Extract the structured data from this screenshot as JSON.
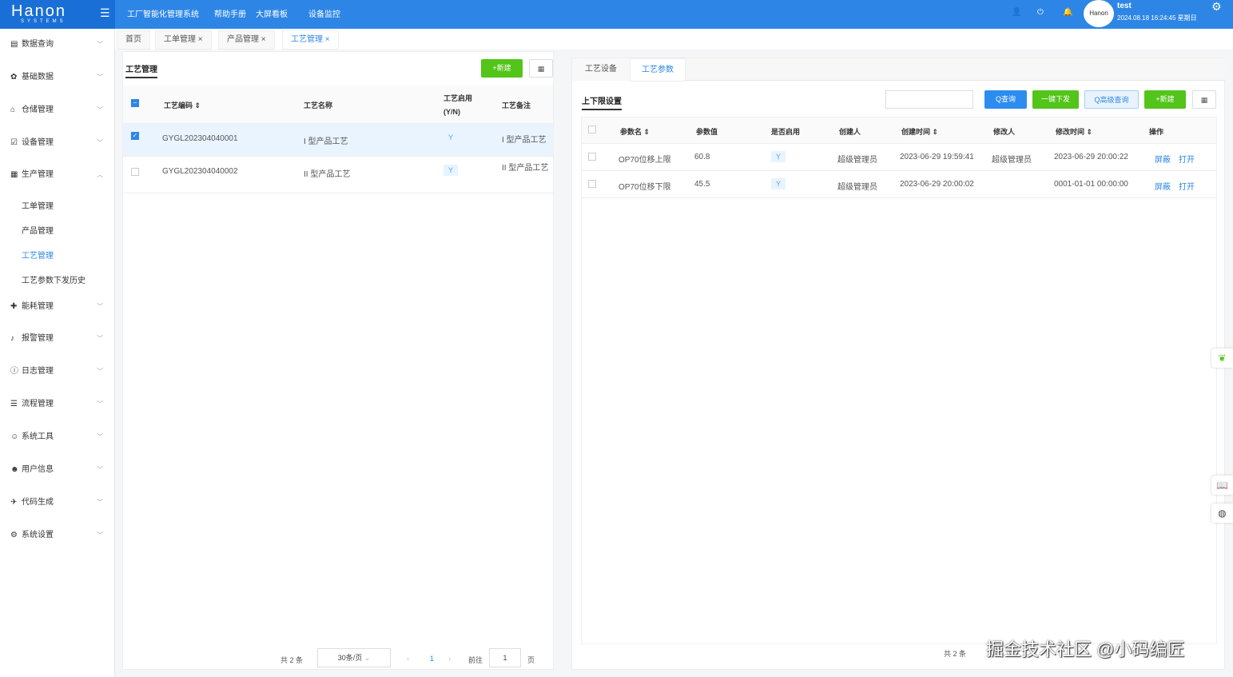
{
  "header": {
    "logo": "Hanon",
    "logo_sub": "SYSTEMS",
    "nav": [
      "工厂智能化管理系统",
      "帮助手册",
      "大屏看板",
      "设备监控"
    ],
    "user": "test",
    "datetime": "2024.08.18 16:24:45 星期日",
    "avatar_text": "Hanon"
  },
  "sidebar": {
    "items": [
      {
        "label": "数据查询",
        "icon": "▤"
      },
      {
        "label": "基础数据",
        "icon": "✿"
      },
      {
        "label": "仓储管理",
        "icon": "⌂"
      },
      {
        "label": "设备管理",
        "icon": "☑"
      },
      {
        "label": "生产管理",
        "icon": "▦"
      },
      {
        "label": "能耗管理",
        "icon": "✚"
      },
      {
        "label": "报警管理",
        "icon": "♪"
      },
      {
        "label": "日志管理",
        "icon": "ⓘ"
      },
      {
        "label": "流程管理",
        "icon": "☰"
      },
      {
        "label": "系统工具",
        "icon": "☺"
      },
      {
        "label": "用户信息",
        "icon": "☻"
      },
      {
        "label": "代码生成",
        "icon": "✈"
      },
      {
        "label": "系统设置",
        "icon": "⚙"
      }
    ],
    "sub_items": [
      "工单管理",
      "产品管理",
      "工艺管理",
      "工艺参数下发历史"
    ],
    "active_sub": "工艺管理"
  },
  "tabs": [
    {
      "label": "首页"
    },
    {
      "label": "工单管理",
      "close": "×"
    },
    {
      "label": "产品管理",
      "close": "×"
    },
    {
      "label": "工艺管理",
      "close": "×"
    }
  ],
  "left": {
    "title": "工艺管理",
    "new_btn": "+新建",
    "grid_btn": "▦",
    "columns": [
      "工艺编码 ⇕",
      "工艺名称",
      "工艺启用(Y/N)",
      "工艺备注"
    ],
    "rows": [
      {
        "code": "GYGL202304040001",
        "name": "I 型产品工艺",
        "enabled": "Y",
        "remark": "I 型产品工艺",
        "checked": true
      },
      {
        "code": "GYGL202304040002",
        "name": "II 型产品工艺",
        "enabled": "Y",
        "remark": "II 型产品工艺",
        "checked": false
      }
    ],
    "pagination": {
      "total": "共 2 条",
      "size": "30条/页",
      "page": "1",
      "goto": "前往",
      "goto_val": "1",
      "page_unit": "页"
    }
  },
  "right": {
    "tabs": [
      "工艺设备",
      "工艺参数"
    ],
    "active_tab": "工艺参数",
    "title": "上下限设置",
    "search_placeholder": "",
    "buttons": {
      "query": "Q查询",
      "dispatch": "一键下发",
      "advanced": "Q高级查询",
      "new": "+新建",
      "grid": "▦"
    },
    "columns": [
      "参数名 ⇕",
      "参数值",
      "是否启用",
      "创建人",
      "创建时间 ⇕",
      "修改人",
      "修改时间 ⇕",
      "操作"
    ],
    "rows": [
      {
        "name": "OP70位移上限",
        "value": "60.8",
        "enabled": "Y",
        "creator": "超级管理员",
        "created": "2023-06-29 19:59:41",
        "modifier": "超级管理员",
        "modified": "2023-06-29 20:00:22",
        "a1": "屏蔽",
        "a2": "打开"
      },
      {
        "name": "OP70位移下限",
        "value": "45.5",
        "enabled": "Y",
        "creator": "超级管理员",
        "created": "2023-06-29 20:00:02",
        "modifier": "",
        "modified": "0001-01-01 00:00:00",
        "a1": "屏蔽",
        "a2": "打开"
      }
    ],
    "total": "共 2 条"
  },
  "watermark": "掘金技术社区 @小码编匠",
  "colors": {
    "primary": "#2d86e6",
    "green": "#52c41a"
  }
}
